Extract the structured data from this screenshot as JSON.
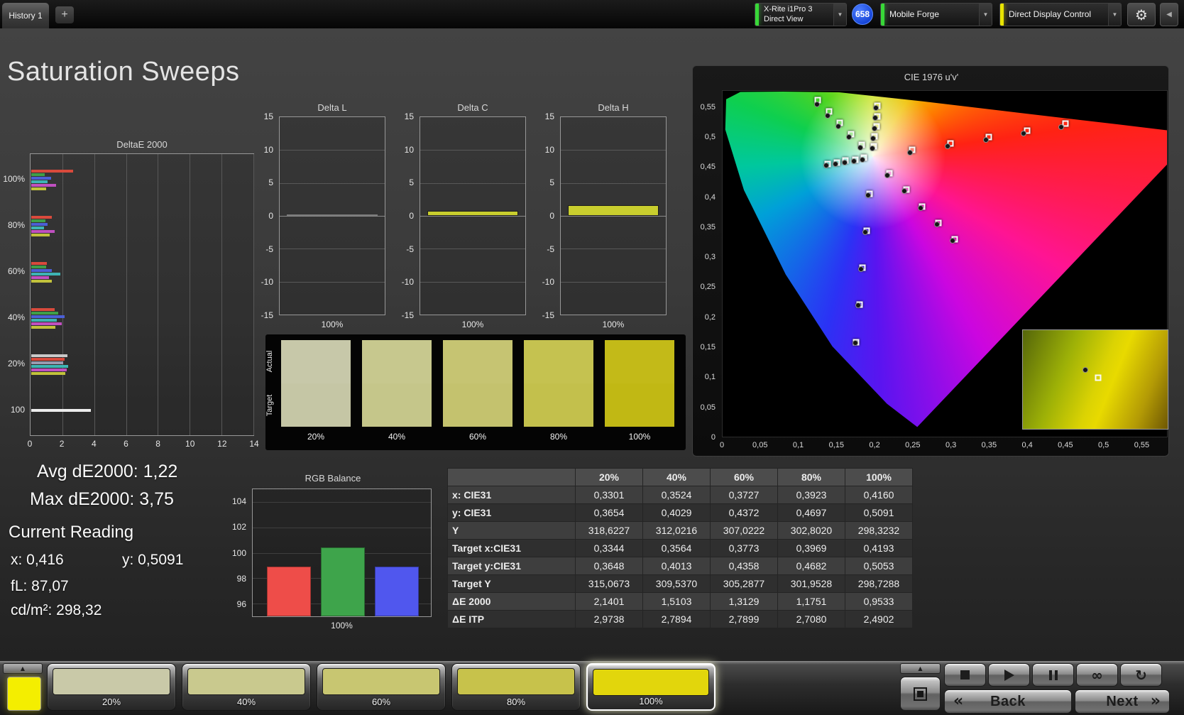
{
  "icons": {
    "chevron_down": "▼",
    "gear": "⚙",
    "collapse_left": "◀",
    "up_arrow": "▲",
    "plus": "+",
    "infinity": "∞",
    "refresh": "↻",
    "back_chevrons": "«",
    "next_chevrons": "»"
  },
  "topbar": {
    "history_tab": "History 1",
    "meter": {
      "line1": "X-Rite i1Pro 3",
      "line2": "Direct View"
    },
    "badge": "658",
    "source_name": "Mobile Forge",
    "display_control": "Direct Display Control"
  },
  "page": {
    "title": "Saturation Sweeps"
  },
  "deltae_chart": {
    "title": "DeltaE 2000",
    "xmax": 14,
    "xticks": [
      0,
      2,
      4,
      6,
      8,
      10,
      12,
      14
    ],
    "groups": [
      {
        "label": "100%",
        "bars": [
          {
            "c": "#d94a3c",
            "v": 2.65
          },
          {
            "c": "#3f9e48",
            "v": 0.85
          },
          {
            "c": "#4b5fd6",
            "v": 1.25
          },
          {
            "c": "#3db4b4",
            "v": 1.05
          },
          {
            "c": "#c050c0",
            "v": 1.55
          },
          {
            "c": "#c2c23c",
            "v": 0.95
          }
        ]
      },
      {
        "label": "80%",
        "bars": [
          {
            "c": "#d94a3c",
            "v": 1.3
          },
          {
            "c": "#3f9e48",
            "v": 0.9
          },
          {
            "c": "#4b5fd6",
            "v": 1.05
          },
          {
            "c": "#3db4b4",
            "v": 0.8
          },
          {
            "c": "#c050c0",
            "v": 1.5
          },
          {
            "c": "#c2c23c",
            "v": 1.18
          }
        ]
      },
      {
        "label": "60%",
        "bars": [
          {
            "c": "#d94a3c",
            "v": 1.0
          },
          {
            "c": "#3f9e48",
            "v": 0.95
          },
          {
            "c": "#4b5fd6",
            "v": 1.3
          },
          {
            "c": "#3db4b4",
            "v": 1.85
          },
          {
            "c": "#c050c0",
            "v": 1.1
          },
          {
            "c": "#c2c23c",
            "v": 1.31
          }
        ]
      },
      {
        "label": "40%",
        "bars": [
          {
            "c": "#d94a3c",
            "v": 1.5
          },
          {
            "c": "#3f9e48",
            "v": 1.7
          },
          {
            "c": "#4b5fd6",
            "v": 2.1
          },
          {
            "c": "#3db4b4",
            "v": 1.6
          },
          {
            "c": "#c050c0",
            "v": 1.95
          },
          {
            "c": "#c2c23c",
            "v": 1.51
          }
        ]
      },
      {
        "label": "20%",
        "bars": [
          {
            "c": "#c9c9c9",
            "v": 2.3
          },
          {
            "c": "#d94a3c",
            "v": 2.1
          },
          {
            "c": "#9a9ab0",
            "v": 2.0
          },
          {
            "c": "#3db4b4",
            "v": 2.35
          },
          {
            "c": "#c050c0",
            "v": 2.25
          },
          {
            "c": "#c2c23c",
            "v": 2.14
          }
        ]
      },
      {
        "label": "100",
        "bars": [
          {
            "c": "#ececec",
            "v": 3.75
          }
        ]
      }
    ]
  },
  "delta_axis": {
    "ymin": -15,
    "ymax": 15,
    "yticks": [
      15,
      10,
      5,
      0,
      -5,
      -10,
      -15
    ]
  },
  "delta_charts": [
    {
      "title": "Delta L",
      "value": 0.1,
      "color": "#0a0a0a",
      "edge": "#7a7a7a",
      "xlabel": "100%"
    },
    {
      "title": "Delta C",
      "value": 0.7,
      "color": "#c9ce2e",
      "edge": "#1c1c1c",
      "xlabel": "100%"
    },
    {
      "title": "Delta H",
      "value": 1.6,
      "color": "#c9ce2e",
      "edge": "#1c1c1c",
      "xlabel": "100%"
    }
  ],
  "swatch_panel": {
    "actual_label": "Actual",
    "target_label": "Target",
    "columns": [
      {
        "label": "20%",
        "actual": "#c7c8a9",
        "target": "#c5c6a5"
      },
      {
        "label": "40%",
        "actual": "#c7c88e",
        "target": "#c5c68a"
      },
      {
        "label": "60%",
        "actual": "#c6c472",
        "target": "#c4c26e"
      },
      {
        "label": "80%",
        "actual": "#c5c250",
        "target": "#c3c04c"
      },
      {
        "label": "100%",
        "actual": "#c3ba18",
        "target": "#c1b814"
      }
    ]
  },
  "cie": {
    "title": "CIE 1976 u'v'",
    "ticks": [
      "0",
      "0,05",
      "0,1",
      "0,15",
      "0,2",
      "0,25",
      "0,3",
      "0,35",
      "0,4",
      "0,45",
      "0,5",
      "0,55"
    ],
    "targets": [
      [
        42.6,
        17.1
      ],
      [
        51.2,
        15.2
      ],
      [
        59.9,
        13.3
      ],
      [
        68.5,
        11.4
      ],
      [
        77.2,
        9.5
      ],
      [
        31.3,
        15.7
      ],
      [
        28.9,
        12.5
      ],
      [
        26.4,
        9.2
      ],
      [
        24.0,
        5.9
      ],
      [
        21.4,
        2.6
      ],
      [
        33.0,
        29.8
      ],
      [
        32.4,
        40.5
      ],
      [
        31.5,
        51.2
      ],
      [
        30.8,
        61.9
      ],
      [
        30.0,
        72.7
      ],
      [
        31.8,
        19.4
      ],
      [
        29.8,
        19.9
      ],
      [
        27.7,
        20.2
      ],
      [
        25.7,
        20.8
      ],
      [
        23.6,
        21.1
      ],
      [
        37.5,
        23.9
      ],
      [
        41.3,
        28.5
      ],
      [
        44.9,
        33.4
      ],
      [
        48.6,
        38.1
      ],
      [
        52.2,
        42.9
      ],
      [
        34.1,
        16.1
      ],
      [
        34.2,
        13.1
      ],
      [
        34.6,
        10.2
      ],
      [
        34.8,
        7.3
      ],
      [
        34.9,
        4.3
      ]
    ],
    "measured": [
      [
        42.2,
        17.8
      ],
      [
        50.6,
        16.0
      ],
      [
        59.2,
        14.2
      ],
      [
        67.8,
        12.3
      ],
      [
        76.2,
        10.4
      ],
      [
        31.0,
        16.4
      ],
      [
        28.5,
        13.4
      ],
      [
        26.0,
        10.3
      ],
      [
        23.6,
        7.1
      ],
      [
        21.2,
        4.0
      ],
      [
        32.7,
        30.2
      ],
      [
        32.1,
        40.8
      ],
      [
        31.2,
        51.5
      ],
      [
        30.5,
        62.1
      ],
      [
        29.8,
        72.9
      ],
      [
        31.5,
        19.9
      ],
      [
        29.5,
        20.3
      ],
      [
        27.4,
        20.7
      ],
      [
        25.4,
        21.2
      ],
      [
        23.3,
        21.6
      ],
      [
        37.1,
        24.4
      ],
      [
        40.9,
        29.0
      ],
      [
        44.5,
        33.8
      ],
      [
        48.2,
        38.6
      ],
      [
        51.7,
        43.4
      ],
      [
        33.7,
        16.6
      ],
      [
        33.9,
        13.7
      ],
      [
        34.2,
        10.8
      ],
      [
        34.4,
        7.9
      ],
      [
        34.5,
        5.0
      ]
    ]
  },
  "stats": {
    "avg": "Avg dE2000: 1,22",
    "max": "Max dE2000: 3,75",
    "heading": "Current Reading",
    "x": "x: 0,416",
    "y": "y: 0,5091",
    "fl": "fL: 87,07",
    "cd": "cd/m²: 298,32"
  },
  "rgb_balance": {
    "title": "RGB Balance",
    "xlabel": "100%",
    "ymin": 95,
    "ymax": 105,
    "yticks": [
      104,
      102,
      100,
      98,
      96
    ],
    "bars": [
      {
        "label": "red",
        "value": 98.9,
        "color": "#ee4d49"
      },
      {
        "label": "green",
        "value": 100.4,
        "color": "#3ea44b"
      },
      {
        "label": "blue",
        "value": 98.9,
        "color": "#5057ee"
      }
    ]
  },
  "table": {
    "columns": [
      "20%",
      "40%",
      "60%",
      "80%",
      "100%"
    ],
    "rows": [
      {
        "label": "x: CIE31",
        "values": [
          "0,3301",
          "0,3524",
          "0,3727",
          "0,3923",
          "0,4160"
        ]
      },
      {
        "label": "y: CIE31",
        "values": [
          "0,3654",
          "0,4029",
          "0,4372",
          "0,4697",
          "0,5091"
        ]
      },
      {
        "label": "Y",
        "values": [
          "318,6227",
          "312,0216",
          "307,0222",
          "302,8020",
          "298,3232"
        ]
      },
      {
        "label": "Target x:CIE31",
        "values": [
          "0,3344",
          "0,3564",
          "0,3773",
          "0,3969",
          "0,4193"
        ]
      },
      {
        "label": "Target y:CIE31",
        "values": [
          "0,3648",
          "0,4013",
          "0,4358",
          "0,4682",
          "0,5053"
        ]
      },
      {
        "label": "Target Y",
        "values": [
          "315,0673",
          "309,5370",
          "305,2877",
          "301,9528",
          "298,7288"
        ]
      },
      {
        "label": "ΔE 2000",
        "values": [
          "2,1401",
          "1,5103",
          "1,3129",
          "1,1751",
          "0,9533"
        ]
      },
      {
        "label": "ΔE ITP",
        "values": [
          "2,9738",
          "2,7894",
          "2,7899",
          "2,7080",
          "2,4902"
        ]
      }
    ]
  },
  "bottombar": {
    "current_color": "#f4ee00",
    "swatches": [
      {
        "label": "20%",
        "color": "#c9c9a8"
      },
      {
        "label": "40%",
        "color": "#c9c98e"
      },
      {
        "label": "60%",
        "color": "#c8c671"
      },
      {
        "label": "80%",
        "color": "#c7c24b"
      },
      {
        "label": "100%",
        "color": "#e2d60c",
        "selected": true
      }
    ],
    "back": "Back",
    "next": "Next"
  }
}
